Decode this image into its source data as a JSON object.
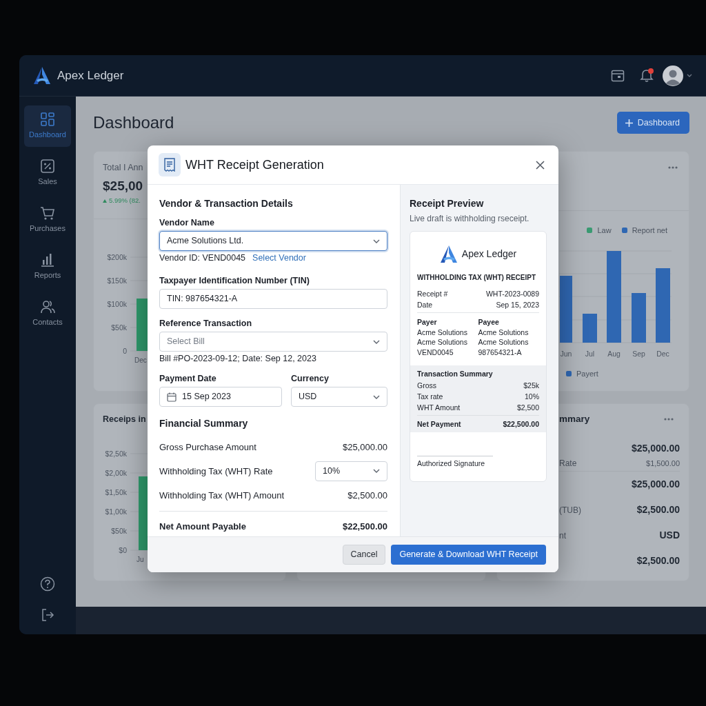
{
  "topbar": {
    "brand": "Apex Ledger",
    "has_notification": true
  },
  "sidebar": {
    "items": [
      {
        "label": "Dashboard",
        "selected": true
      },
      {
        "label": "Sales",
        "selected": false
      },
      {
        "label": "Purchases",
        "selected": false
      },
      {
        "label": "Reports",
        "selected": false
      },
      {
        "label": "Contacts",
        "selected": false
      }
    ]
  },
  "page": {
    "title": "Dashboard",
    "primary_button": "Dashboard"
  },
  "background_cards": {
    "revenue": {
      "title": "Total I Ann",
      "value": "$25,00",
      "change": "5.99% (82.",
      "y_labels": [
        "$200k",
        "$150k",
        "$100k",
        "$50k",
        "0"
      ],
      "x_labels": [
        "Dec"
      ]
    },
    "monthly": {
      "legend": [
        {
          "label": "Law",
          "color": "#3a9a72"
        },
        {
          "label": "Report net",
          "color": "#2f67b2"
        }
      ],
      "x_labels": [
        "Jun",
        "Jul",
        "Aug",
        "Sep",
        "Dec"
      ],
      "bottom_legend": [
        {
          "label": "Payert",
          "color": "#2f67b2"
        }
      ]
    },
    "receipts": {
      "title": "Receips in",
      "y_labels": [
        "$2,50k",
        "$2,00k",
        "$1,50k",
        "$1,00k",
        "$50k",
        "$0"
      ],
      "x_labels": [
        "Ju"
      ]
    },
    "summary": {
      "title": "mmary",
      "rows": [
        {
          "kind": "main",
          "value": "$25,000.00"
        },
        {
          "kind": "sub",
          "label": "Rate",
          "value": "$1,500.00"
        },
        {
          "kind": "main",
          "value": "$25,000.00"
        },
        {
          "kind": "main",
          "label": "(TUB)",
          "value": "$2,500.00"
        },
        {
          "kind": "main",
          "label": "nt",
          "value": "USD"
        },
        {
          "kind": "main",
          "value": "$2,500.00"
        }
      ]
    }
  },
  "modal": {
    "title": "WHT Receipt Generation",
    "form": {
      "section_title": "Vendor & Transaction Details",
      "vendor": {
        "label": "Vendor Name",
        "value": "Acme Solutions Ltd.",
        "focused": true,
        "hint": "Vendor ID: VEND0045",
        "link": "Select Vendor"
      },
      "tin": {
        "label": "Taxpayer Identification Number (TIN)",
        "value": "TIN: 987654321-A"
      },
      "reference": {
        "label": "Reference Transaction",
        "placeholder": "Select Bill",
        "hint": "Bill #PO-2023-09-12; Date: Sep 12, 2023"
      },
      "payment_date": {
        "label": "Payment Date",
        "value": "15 Sep 2023"
      },
      "currency": {
        "label": "Currency",
        "value": "USD"
      }
    },
    "summary": {
      "title": "Financial Summary",
      "rows": [
        {
          "kind": "text",
          "label": "Gross Purchase Amount",
          "value": "$25,000.00"
        },
        {
          "kind": "select",
          "label": "Withholding Tax (WHT) Rate",
          "value": "10%"
        },
        {
          "kind": "text",
          "label": "Withholding Tax (WHT) Amount",
          "value": "$2,500.00"
        },
        {
          "kind": "total",
          "label": "Net Amount Payable",
          "value": "$22,500.00"
        }
      ]
    },
    "preview": {
      "title": "Receipt Preview",
      "subtitle": "Live draft is withholding rseceipt.",
      "brand": "Apex Ledger",
      "heading": "WITHHOLDING TAX (WHT) RECEIPT",
      "meta": [
        {
          "label": "Receipt #",
          "value": "WHT-2023-0089"
        },
        {
          "label": "Date",
          "value": "Sep 15, 2023"
        }
      ],
      "parties": [
        {
          "title": "Payer",
          "lines": [
            "Acme Solutions",
            "Acme Solutions",
            "VEND0045"
          ]
        },
        {
          "title": "Payee",
          "lines": [
            "Acme Solutions",
            "Acme Solutions",
            "987654321-A"
          ]
        }
      ],
      "summary_title": "Transaction Summary",
      "summary": [
        {
          "label": "Gross",
          "value": "$25k"
        },
        {
          "label": "Tax rate",
          "value": "10%"
        },
        {
          "label": "WHT Amount",
          "value": "$2,500"
        }
      ],
      "net": {
        "label": "Net Payment",
        "value": "$22,500.00"
      },
      "signature": "Authorized Signature"
    },
    "buttons": [
      {
        "label": "Cancel",
        "kind": "secondary"
      },
      {
        "label": "Generate & Download WHT Receipt",
        "kind": "primary"
      }
    ]
  }
}
